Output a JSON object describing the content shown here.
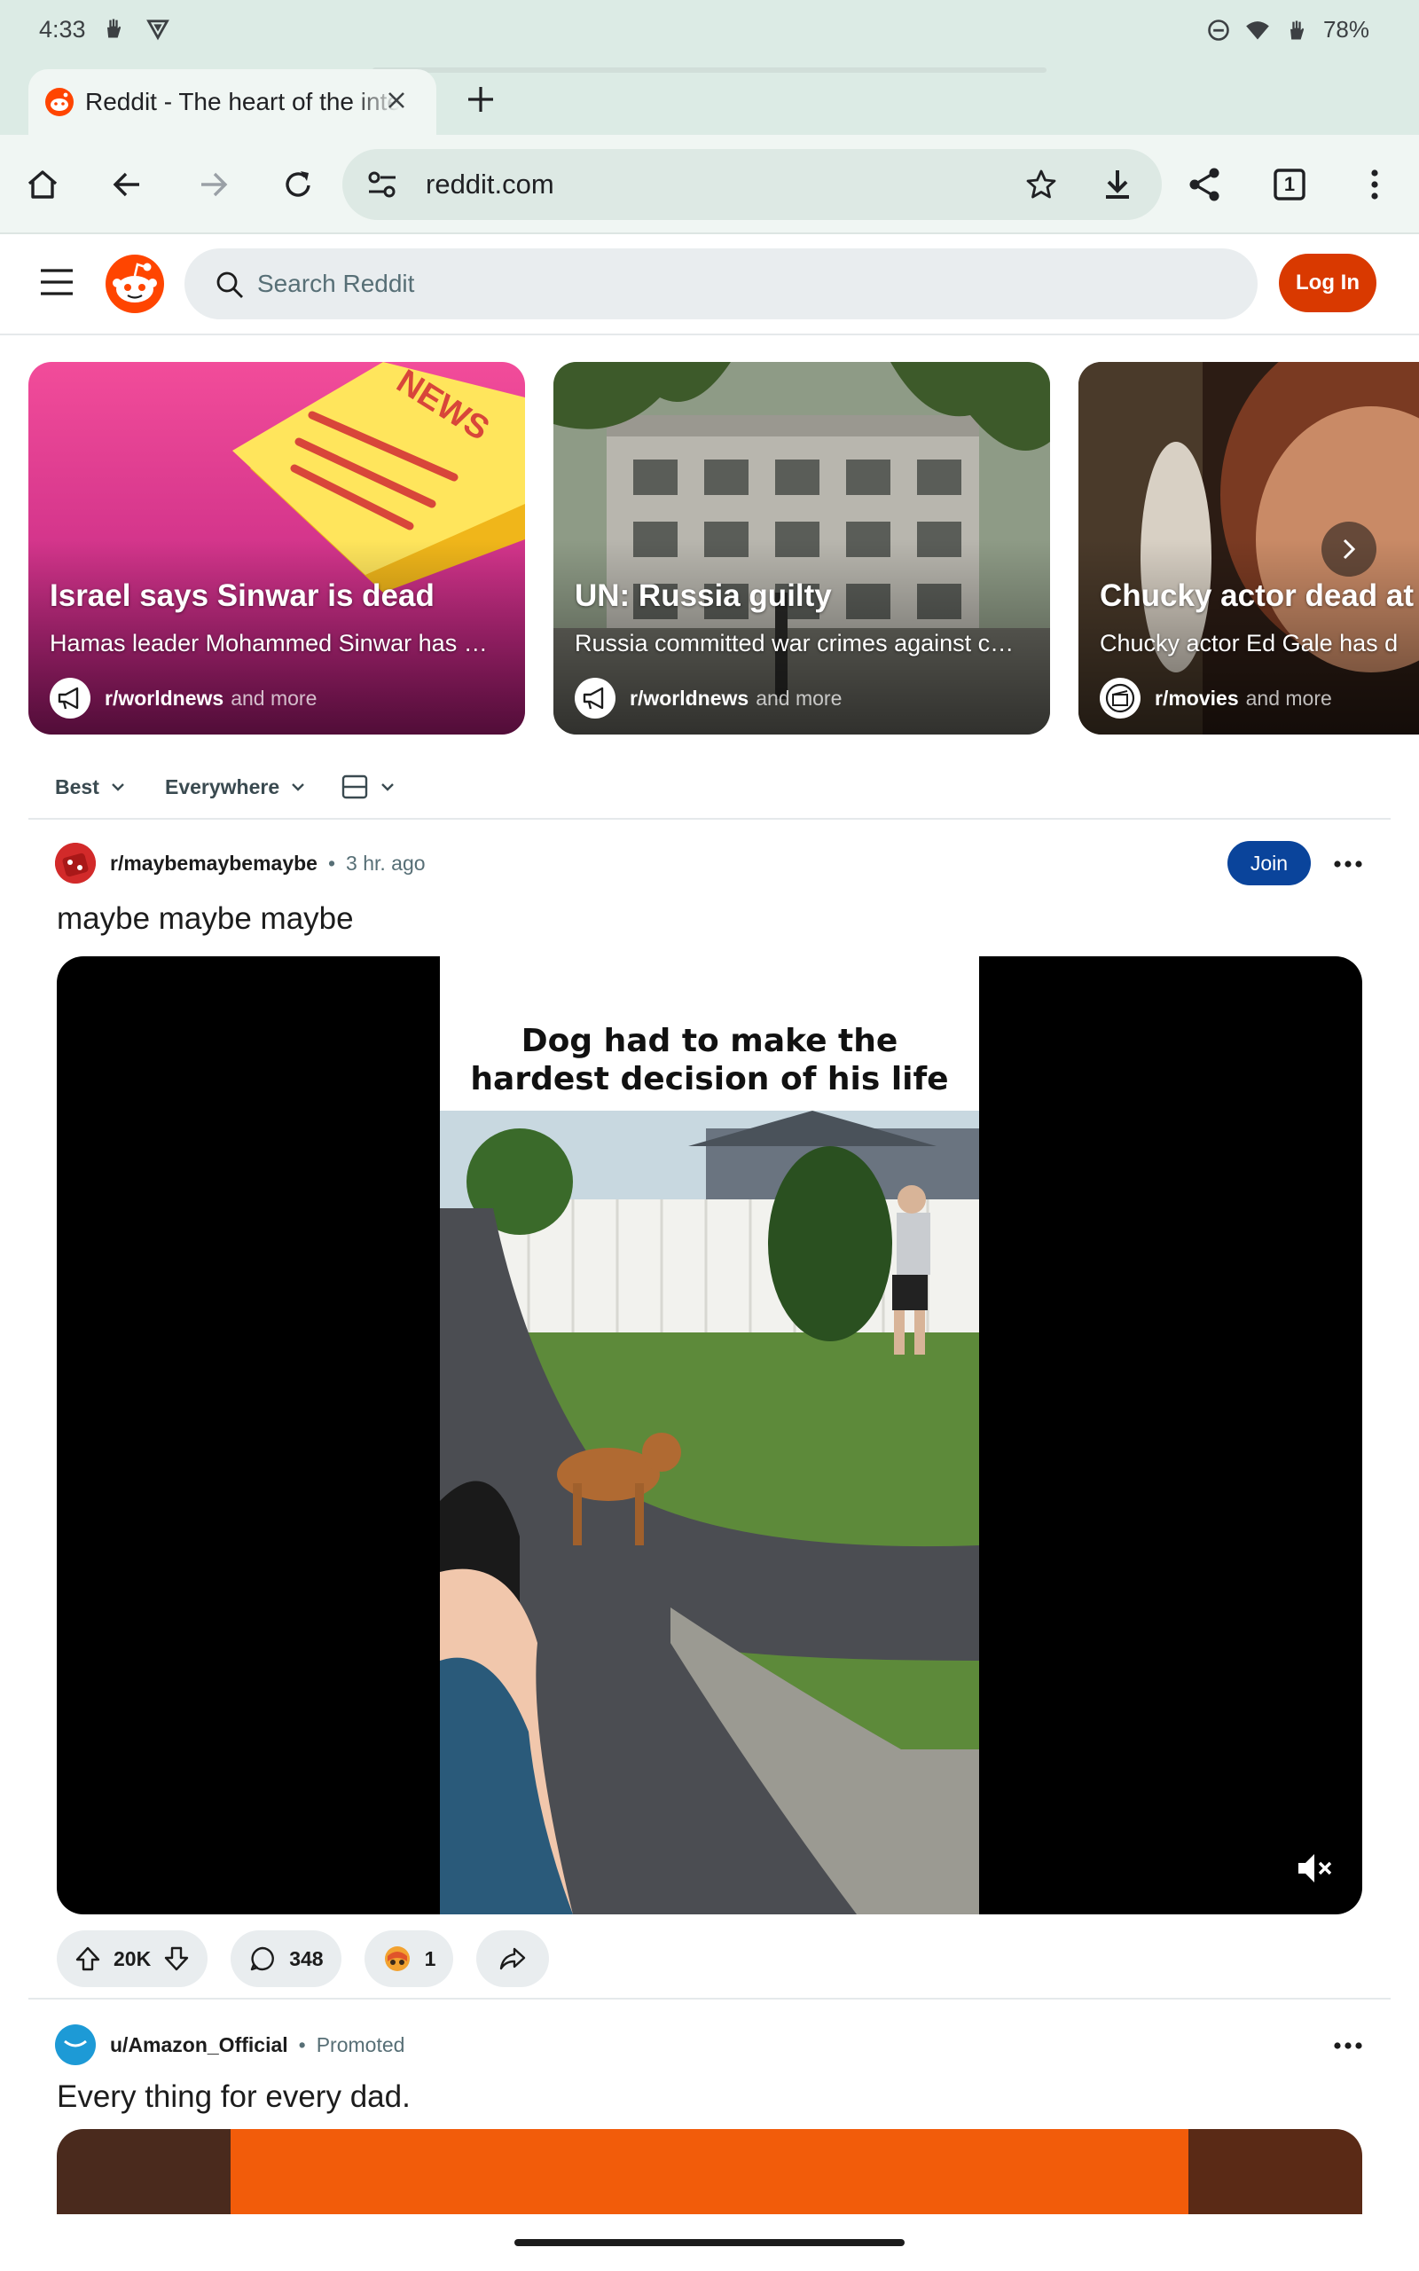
{
  "status_bar": {
    "time": "4:33",
    "battery": "78%"
  },
  "browser": {
    "tab_title": "Reddit - The heart of the internet",
    "url": "reddit.com",
    "tab_count": "1"
  },
  "reddit": {
    "search_placeholder": "Search Reddit",
    "login_label": "Log In"
  },
  "trending": [
    {
      "title": "Israel says Sinwar is dead",
      "desc": "Hamas leader Mohammed Sinwar has …",
      "subreddit": "r/worldnews",
      "more": "and more"
    },
    {
      "title": "UN: Russia guilty",
      "desc": "Russia committed war crimes against c…",
      "subreddit": "r/worldnews",
      "more": "and more"
    },
    {
      "title": "Chucky actor dead at",
      "desc": "Chucky actor Ed Gale has d",
      "subreddit": "r/movies",
      "more": "and more"
    }
  ],
  "card1_image_text": "NEWS",
  "sort": {
    "best": "Best",
    "scope": "Everywhere"
  },
  "post": {
    "subreddit": "r/maybemaybemaybe",
    "separator": "•",
    "time": "3 hr. ago",
    "join_label": "Join",
    "title": "maybe maybe maybe",
    "video_caption_line1": "Dog had to make the",
    "video_caption_line2": "hardest decision of his life",
    "upvotes": "20K",
    "comments": "348",
    "awards": "1"
  },
  "promo": {
    "user": "u/Amazon_Official",
    "label": "Promoted",
    "title": "Every thing for every dad."
  },
  "colors": {
    "reddit_orange": "#d93900",
    "join_blue": "#0a449b",
    "chrome_bg": "#dcebe5"
  }
}
